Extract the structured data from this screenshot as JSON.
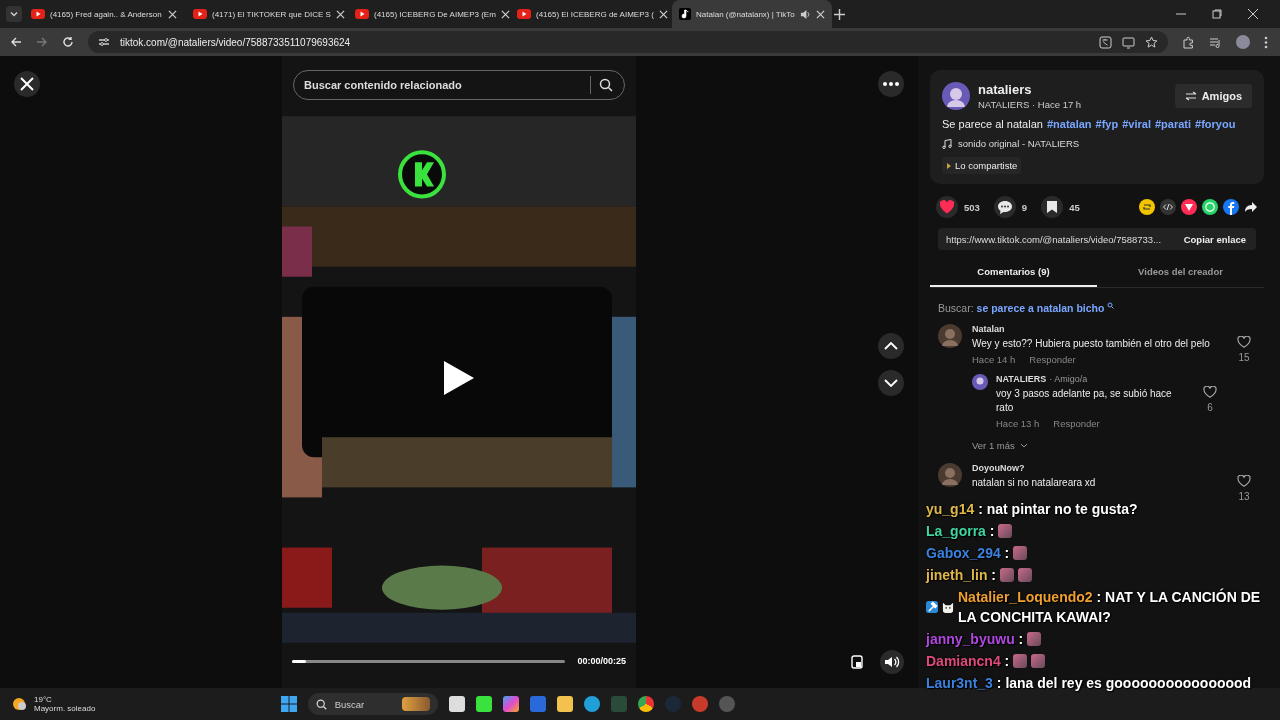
{
  "browser": {
    "tabs": [
      {
        "title": "(4165) Fred again.. & Anderson",
        "selected": false,
        "audio": false
      },
      {
        "title": "(4171) El TIKTOKER que DICE S",
        "selected": false,
        "audio": false
      },
      {
        "title": "(4165) ICEBERG De AIMEP3 (Em",
        "selected": false,
        "audio": false
      },
      {
        "title": "(4165) El ICEBERG de AIMEP3 (",
        "selected": false,
        "audio": false
      },
      {
        "title": "Natalan (@natalanx) | TikTo",
        "selected": true,
        "audio": true
      }
    ],
    "url": "tiktok.com/@nataliers/video/7588733511079693624"
  },
  "video": {
    "search": {
      "placeholder": "Buscar contenido relacionado"
    },
    "progress": {
      "level": 0.05
    },
    "time": "00:00/00:25"
  },
  "post": {
    "author": "nataliers",
    "meta": "NATALIERS · Hace 17 h",
    "follow_button": "Amigos",
    "description": [
      {
        "kind": "text",
        "text": "Se parece al natalan"
      },
      {
        "kind": "hashtag",
        "text": "#natalan"
      },
      {
        "kind": "hashtag",
        "text": "#fyp"
      },
      {
        "kind": "hashtag",
        "text": "#viral"
      },
      {
        "kind": "hashtag",
        "text": "#parati"
      },
      {
        "kind": "hashtag",
        "text": "#foryou"
      }
    ],
    "sound": "sonido original - NATALIERS",
    "shared_badge": "Lo compartiste",
    "stats": [
      {
        "kind": "like",
        "count": "503",
        "selected": true
      },
      {
        "kind": "comment",
        "count": "9",
        "selected": false
      },
      {
        "kind": "bookmark",
        "count": "45",
        "selected": false
      }
    ],
    "link": "https://www.tiktok.com/@nataliers/video/7588733...",
    "copy_button": "Copiar enlace",
    "tabs": [
      {
        "label": "Comentarios (9)",
        "selected": true
      },
      {
        "label": "Videos del creador",
        "selected": false
      }
    ],
    "search_hint": {
      "label": "Buscar:",
      "query": "se parece a natalan bicho"
    }
  },
  "comments": [
    {
      "author": "Natalan",
      "text": "Wey y esto?? Hubiera puesto también el otro del pelo",
      "time": "Hace 14 h",
      "reply": "Responder",
      "likes": "15",
      "children": [
        {
          "author": "NATALIERS",
          "tag": "· Amigo/a",
          "text": "voy 3 pasos adelante pa, se subió hace rato",
          "time": "Hace 13 h",
          "reply": "Responder",
          "likes": "6"
        }
      ],
      "more": "Ver 1 más"
    },
    {
      "author": "DoyouNow?",
      "text": "natalan si no natalareara xd",
      "likes": "13"
    }
  ],
  "chat": [
    {
      "user": "yu_g14",
      "color": "#e0b84a",
      "separator": ":",
      "parts": [
        {
          "kind": "text",
          "text": "nat pintar no te gusta?"
        }
      ]
    },
    {
      "user": "La_gorra",
      "color": "#3fd6a0",
      "separator": ":",
      "parts": [
        {
          "kind": "emote"
        }
      ]
    },
    {
      "user": "Gabox_294",
      "color": "#3b82e0",
      "separator": ":",
      "parts": [
        {
          "kind": "emote"
        }
      ]
    },
    {
      "user": "jineth_lin",
      "color": "#e0b84a",
      "separator": ":",
      "parts": [
        {
          "kind": "emote"
        },
        {
          "kind": "emote"
        }
      ]
    },
    {
      "user": "Natalier_Loquendo2",
      "color": "#f0a030",
      "badges": [
        {
          "kind": "hammer"
        },
        {
          "kind": "cat"
        }
      ],
      "separator": ":",
      "parts": [
        {
          "kind": "text",
          "text": "NAT Y LA CANCIÓN DE LA CONCHITA KAWAI?"
        }
      ]
    },
    {
      "user": "janny_byuwu",
      "color": "#b048e0",
      "separator": ":",
      "parts": [
        {
          "kind": "emote"
        }
      ]
    },
    {
      "user": "Damiancn4",
      "color": "#e04a7a",
      "separator": ":",
      "parts": [
        {
          "kind": "emote"
        },
        {
          "kind": "emote"
        }
      ]
    },
    {
      "user": "Laur3nt_3",
      "color": "#3b82e0",
      "separator": ":",
      "parts": [
        {
          "kind": "text",
          "text": "lana del rey es goooooooooooooood"
        }
      ]
    }
  ],
  "taskbar": {
    "temperature": "19°C",
    "weather": "Mayorm. soleado",
    "search": "Buscar"
  }
}
